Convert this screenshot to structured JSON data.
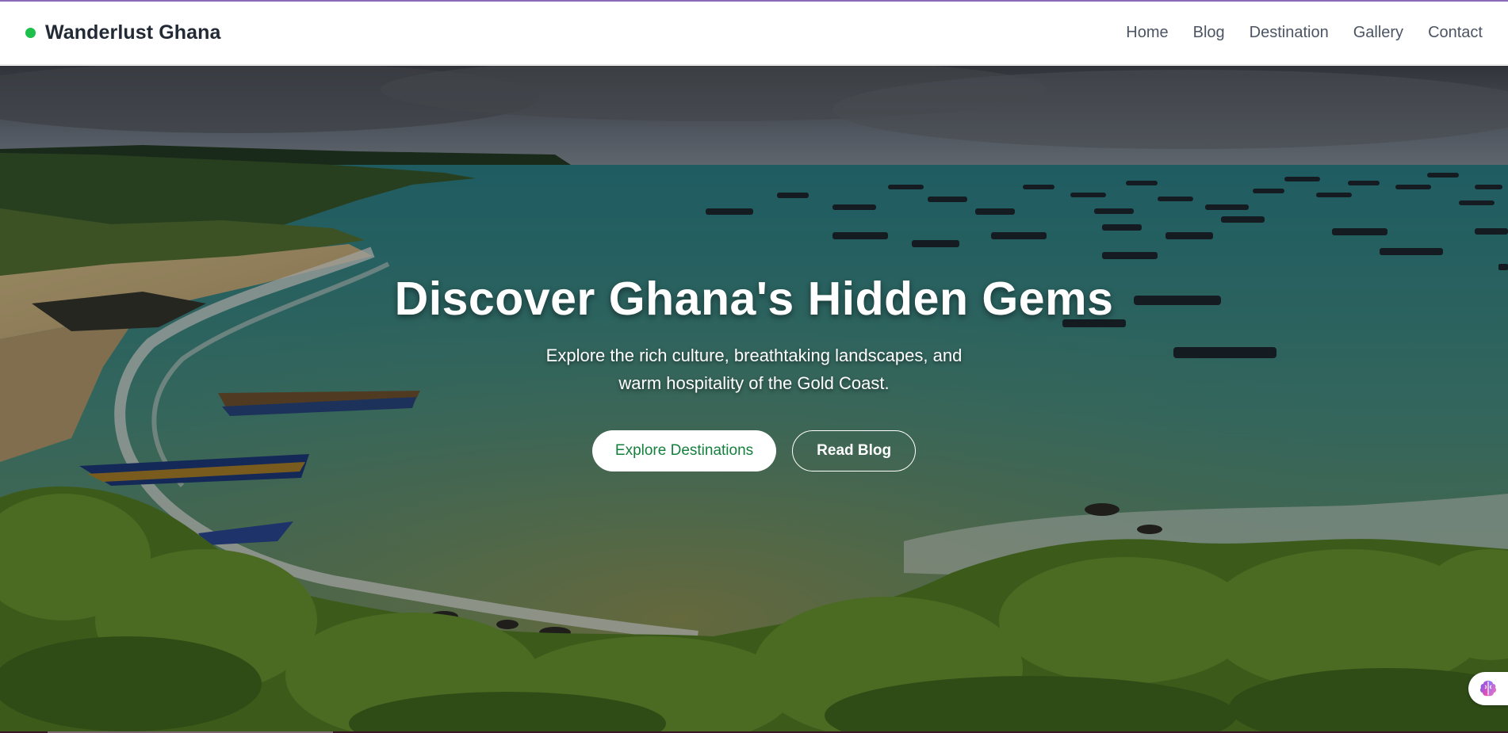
{
  "brand": {
    "name": "Wanderlust Ghana",
    "dot_color": "#1cc04a"
  },
  "nav": {
    "items": [
      "Home",
      "Blog",
      "Destination",
      "Gallery",
      "Contact"
    ]
  },
  "hero": {
    "title": "Discover Ghana's Hidden Gems",
    "subtitle": "Explore the rich culture, breathtaking landscapes, and warm hospitality of the Gold Coast.",
    "primary_button": "Explore Destinations",
    "secondary_button": "Read Blog",
    "background": "coastal beach with fishing boats"
  },
  "floating_widget": {
    "icon": "brain-icon"
  },
  "colors": {
    "accent_green": "#15803d",
    "nav_text": "#4b5563",
    "brand_text": "#222a36"
  }
}
